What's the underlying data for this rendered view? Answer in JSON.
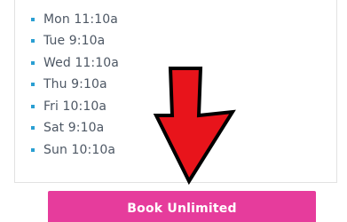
{
  "schedule": {
    "items": [
      {
        "label": "Mon 11:10a"
      },
      {
        "label": "Tue 9:10a"
      },
      {
        "label": "Wed 11:10a"
      },
      {
        "label": "Thu 9:10a"
      },
      {
        "label": "Fri 10:10a"
      },
      {
        "label": "Sat 9:10a"
      },
      {
        "label": "Sun 10:10a"
      }
    ],
    "bullet_color": "#2a9fd2",
    "text_color": "#4d5764"
  },
  "arrow": {
    "icon": "down-arrow-icon",
    "color": "#e8141b"
  },
  "book_button": {
    "label": "Book Unlimited",
    "color": "#e63c9c"
  }
}
